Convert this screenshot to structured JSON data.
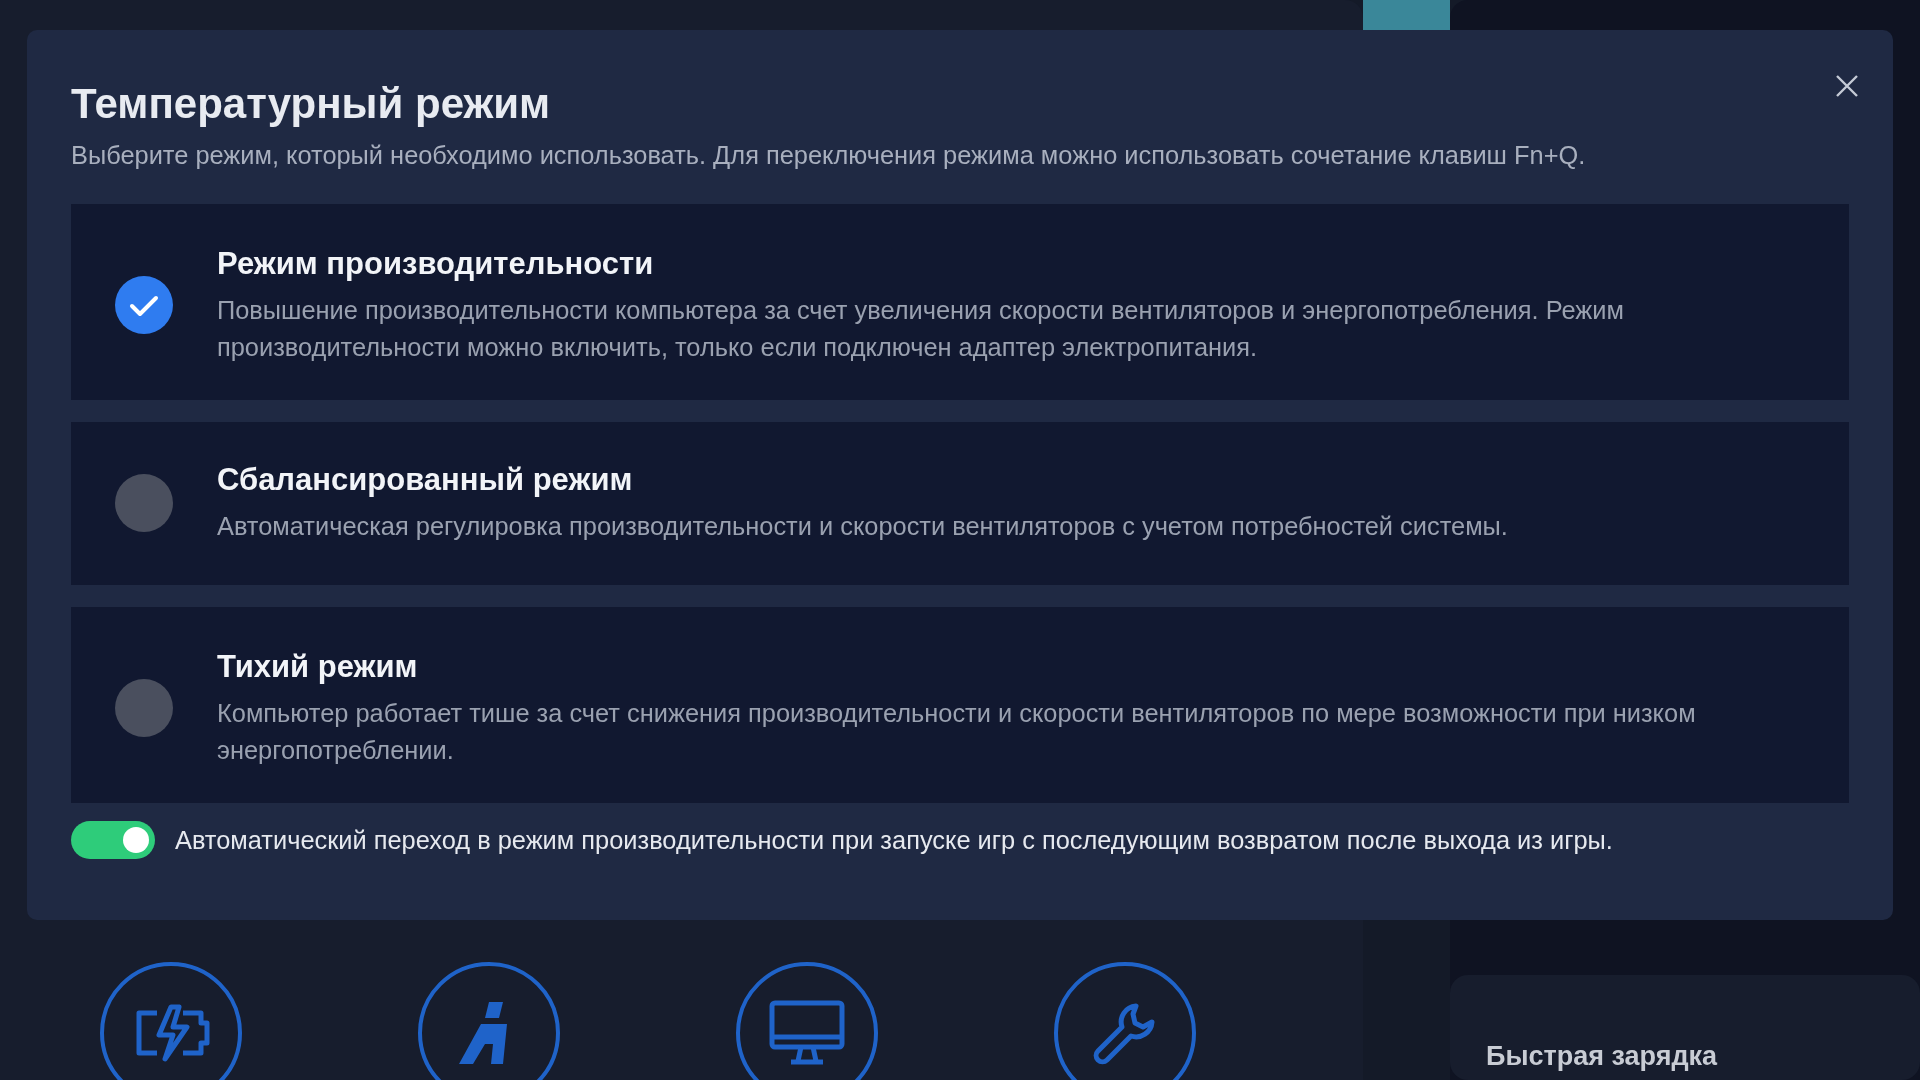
{
  "background": {
    "quick_setting": "Быстрая зарядка",
    "shortcuts": [
      {
        "kind": "battery"
      },
      {
        "kind": "logo"
      },
      {
        "kind": "monitor"
      },
      {
        "kind": "wrench"
      }
    ]
  },
  "dialog": {
    "title": "Температурный режим",
    "subtitle": "Выберите режим, который необходимо использовать. Для переключения режима можно использовать сочетание клавиш Fn+Q.",
    "modes": [
      {
        "name": "Режим производительности",
        "description": "Повышение производительности компьютера за счет увеличения скорости вентиляторов и энергопотребления. Режим производительности можно включить, только если подключен адаптер электропитания.",
        "selected": true
      },
      {
        "name": "Сбалансированный режим",
        "description": "Автоматическая регулировка производительности и скорости вентиляторов с учетом потребностей системы.",
        "selected": false
      },
      {
        "name": "Тихий режим",
        "description": "Компьютер работает тише за счет снижения производительности и скорости вентиляторов по мере возможности при низком энергопотреблении.",
        "selected": false
      }
    ],
    "auto_switch": {
      "label": "Автоматический переход в режим производительности при запуске игр с последующим возвратом после выхода из игры.",
      "on": true
    }
  }
}
